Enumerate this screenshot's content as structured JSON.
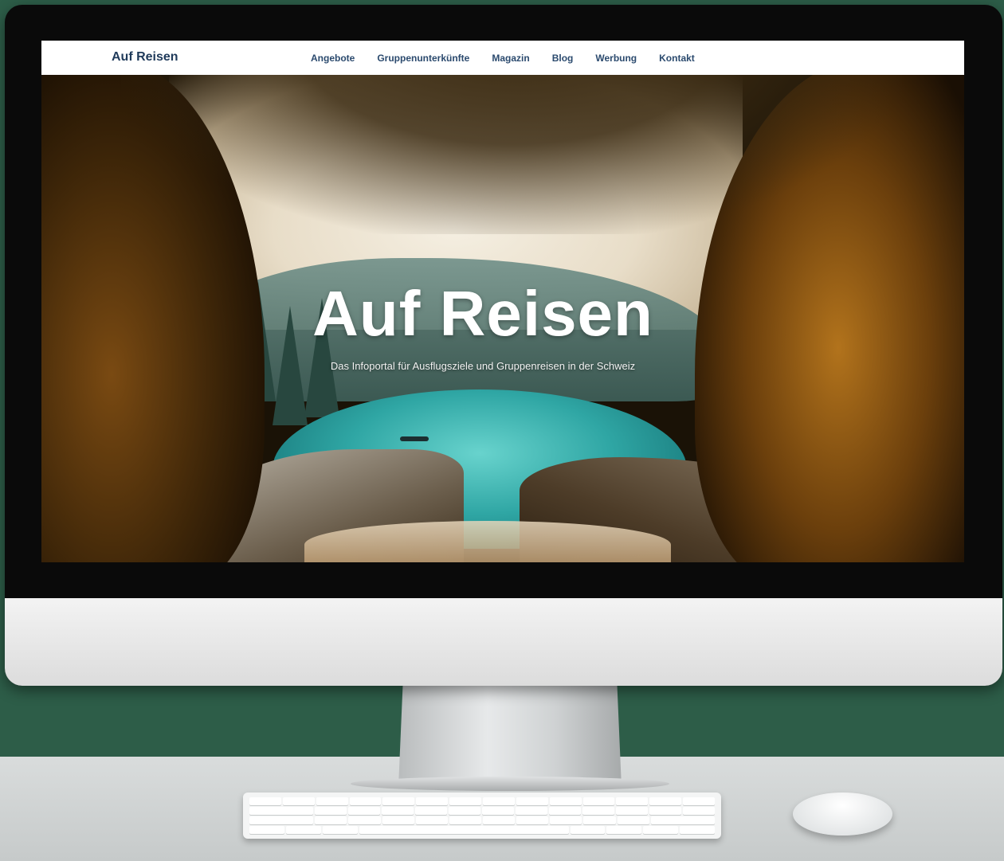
{
  "navbar": {
    "brand": "Auf Reisen",
    "items": [
      {
        "label": "Angebote"
      },
      {
        "label": "Gruppenunterkünfte"
      },
      {
        "label": "Magazin"
      },
      {
        "label": "Blog"
      },
      {
        "label": "Werbung"
      },
      {
        "label": "Kontakt"
      }
    ]
  },
  "hero": {
    "title": "Auf Reisen",
    "subtitle": "Das Infoportal für Ausflugsziele und Gruppenreisen in der Schweiz"
  },
  "colors": {
    "background": "#2d5d48",
    "nav_text": "#2b4a6e",
    "brand_text": "#1f3a5a",
    "hero_text": "#ffffff"
  }
}
